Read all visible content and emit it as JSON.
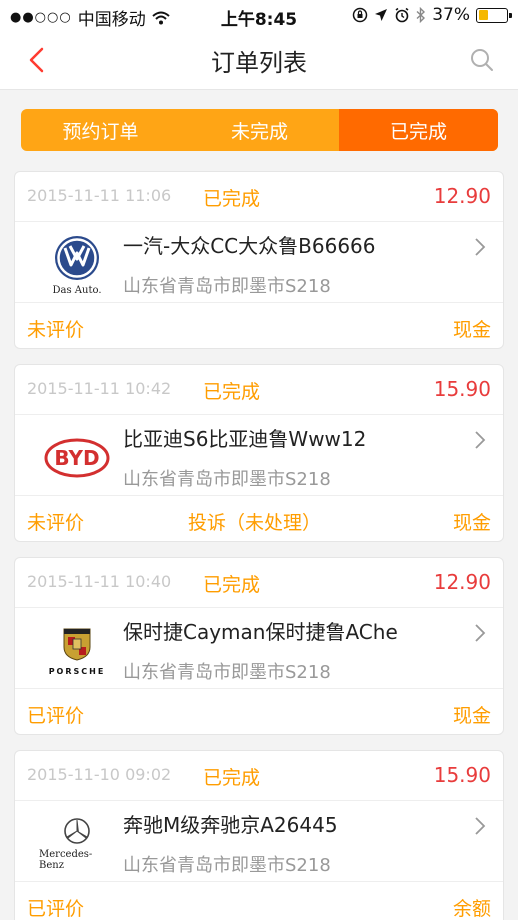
{
  "status_bar": {
    "carrier": "中国移动",
    "signal_icon": "signal-dots-icon",
    "wifi_icon": "wifi-icon",
    "time": "上午8:45",
    "icons": [
      "lock-rotation-icon",
      "location-arrow-icon",
      "alarm-icon",
      "bluetooth-icon"
    ],
    "battery_percent": "37%",
    "battery_level": 0.37,
    "battery_color": "#f5b800"
  },
  "nav": {
    "title": "订单列表",
    "back_icon": "back-chevron-icon",
    "search_icon": "search-icon",
    "accent": "#ff3b30"
  },
  "tabs": {
    "items": [
      {
        "label": "预约订单",
        "active": false
      },
      {
        "label": "未完成",
        "active": false
      },
      {
        "label": "已完成",
        "active": true
      }
    ],
    "color": "#ffa515",
    "active_color": "#ff6a00"
  },
  "orders": [
    {
      "time": "2015-11-11 11:06",
      "status": "已完成",
      "price": "12.90",
      "brand": "volkswagen",
      "brand_caption": "Das Auto.",
      "car": "一汽-大众CC大众鲁B66666",
      "address": "山东省青岛市即墨市S218",
      "rating": "未评价",
      "complaint": "",
      "payment": "现金"
    },
    {
      "time": "2015-11-11 10:42",
      "status": "已完成",
      "price": "15.90",
      "brand": "byd",
      "brand_caption": "BYD",
      "car": "比亚迪S6比亚迪鲁Www12",
      "address": "山东省青岛市即墨市S218",
      "rating": "未评价",
      "complaint": "投诉（未处理）",
      "payment": "现金"
    },
    {
      "time": "2015-11-11 10:40",
      "status": "已完成",
      "price": "12.90",
      "brand": "porsche",
      "brand_caption": "PORSCHE",
      "car": "保时捷Cayman保时捷鲁AChe",
      "address": "山东省青岛市即墨市S218",
      "rating": "已评价",
      "complaint": "",
      "payment": "现金"
    },
    {
      "time": "2015-11-10 09:02",
      "status": "已完成",
      "price": "15.90",
      "brand": "mercedes",
      "brand_caption": "Mercedes-Benz",
      "car": "奔驰M级奔驰京A26445",
      "address": "山东省青岛市即墨市S218",
      "rating": "已评价",
      "complaint": "",
      "payment": "余额"
    }
  ]
}
